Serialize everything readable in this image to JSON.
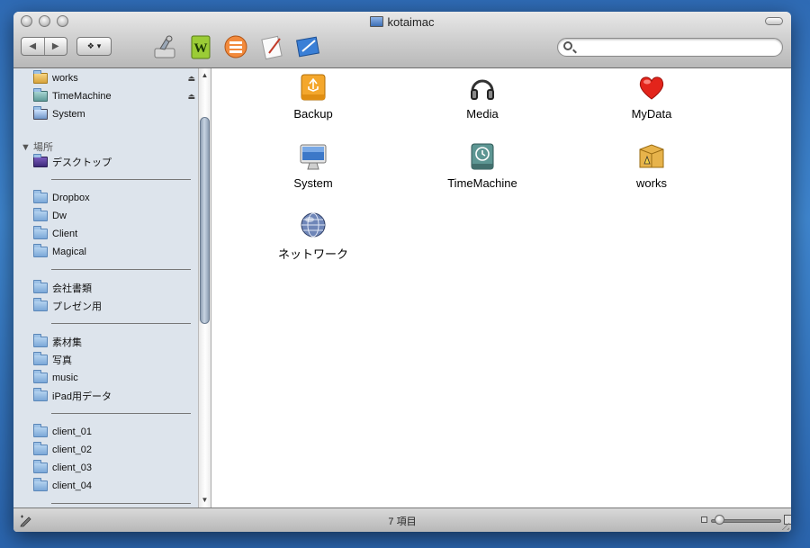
{
  "window": {
    "title": "kotaimac"
  },
  "search": {
    "value": "",
    "placeholder": ""
  },
  "sidebar": {
    "devices": [
      {
        "label": "works",
        "eject": "⏏"
      },
      {
        "label": "TimeMachine",
        "eject": "⏏"
      },
      {
        "label": "System"
      }
    ],
    "places_header": "▼ 場所",
    "places_first": "デスクトップ",
    "groups": [
      [
        "Dropbox",
        "Dw",
        "Client",
        "Magical"
      ],
      [
        "会社書類",
        "プレゼン用"
      ],
      [
        "素材集",
        "写真",
        "music",
        "iPad用データ"
      ],
      [
        "client_01",
        "client_02",
        "client_03",
        "client_04"
      ]
    ]
  },
  "content": {
    "items": [
      {
        "label": "Backup",
        "icon": "usb-drive-icon"
      },
      {
        "label": "Media",
        "icon": "headphones-icon"
      },
      {
        "label": "MyData",
        "icon": "heart-icon"
      },
      {
        "label": "System",
        "icon": "imac-icon"
      },
      {
        "label": "TimeMachine",
        "icon": "timemachine-drive-icon"
      },
      {
        "label": "works",
        "icon": "works-box-icon"
      },
      {
        "label": "ネットワーク",
        "icon": "network-globe-icon"
      }
    ]
  },
  "status": {
    "text": "7 項目"
  },
  "colors": {
    "sidebar_bg": "#dde4ec",
    "desktop": "#3f86cf"
  }
}
